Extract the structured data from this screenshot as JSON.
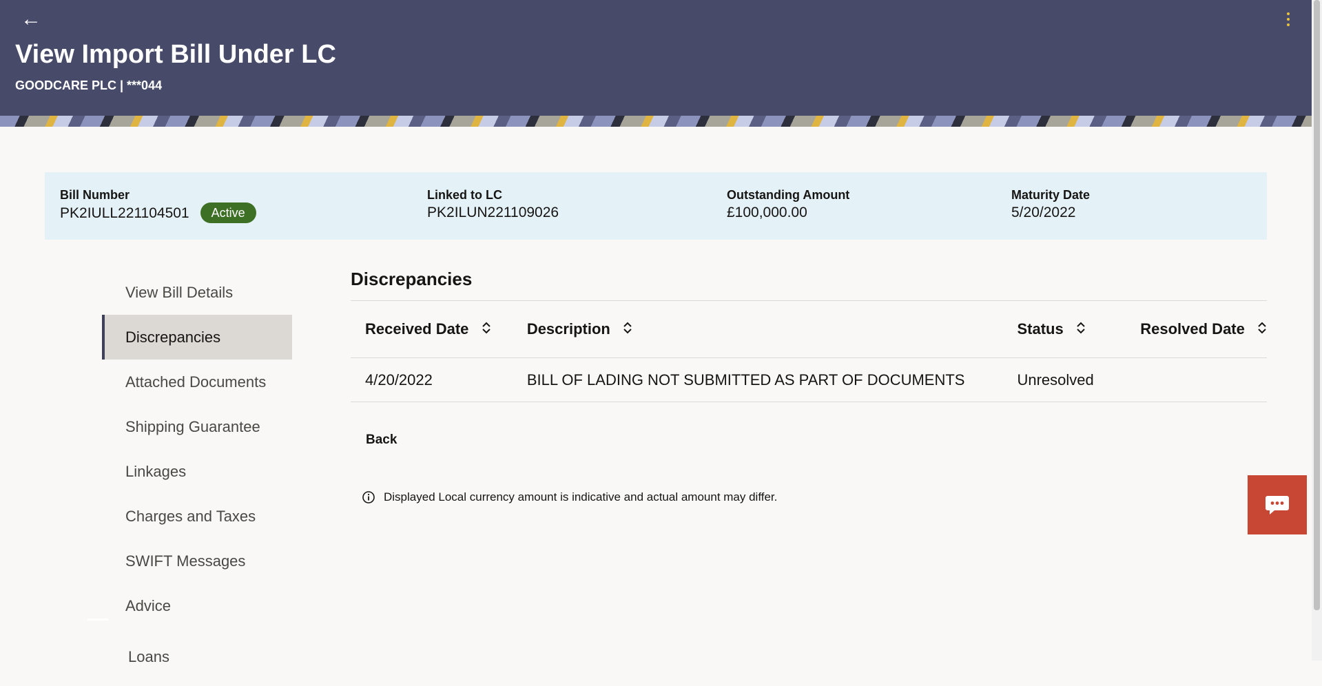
{
  "header": {
    "back_icon": "arrow-left-icon",
    "title": "View Import Bill Under LC",
    "subtitle": "GOODCARE PLC | ***044",
    "menu_icon": "kebab-menu-icon",
    "colors": {
      "background": "#474a68",
      "accent": "#e8c341"
    }
  },
  "summary": {
    "bill_number_label": "Bill Number",
    "bill_number": "PK2IULL221104501",
    "status": "Active",
    "linked_lc_label": "Linked to LC",
    "linked_lc": "PK2ILUN221109026",
    "outstanding_label": "Outstanding Amount",
    "outstanding": "£100,000.00",
    "maturity_label": "Maturity Date",
    "maturity": "5/20/2022",
    "colors": {
      "background": "#e4f1f7",
      "status_badge": "#3d6f24"
    }
  },
  "sidebar": {
    "items": [
      {
        "label": "View Bill Details"
      },
      {
        "label": "Discrepancies",
        "active": true
      },
      {
        "label": "Attached Documents"
      },
      {
        "label": "Shipping Guarantee"
      },
      {
        "label": "Linkages"
      },
      {
        "label": "Charges and Taxes"
      },
      {
        "label": "SWIFT Messages"
      },
      {
        "label": "Advice"
      },
      {
        "label": "Loans"
      }
    ]
  },
  "main": {
    "section_title": "Discrepancies",
    "table": {
      "columns": [
        "Received Date",
        "Description",
        "Status",
        "Resolved Date"
      ],
      "rows": [
        [
          "4/20/2022",
          "BILL OF LADING NOT SUBMITTED AS PART OF DOCUMENTS",
          "Unresolved",
          ""
        ]
      ]
    },
    "back_label": "Back",
    "note": "Displayed Local currency amount is indicative and actual amount may differ.",
    "note_icon": "info-icon"
  },
  "chat": {
    "icon": "chat-bubble-icon",
    "color": "#c74634"
  }
}
